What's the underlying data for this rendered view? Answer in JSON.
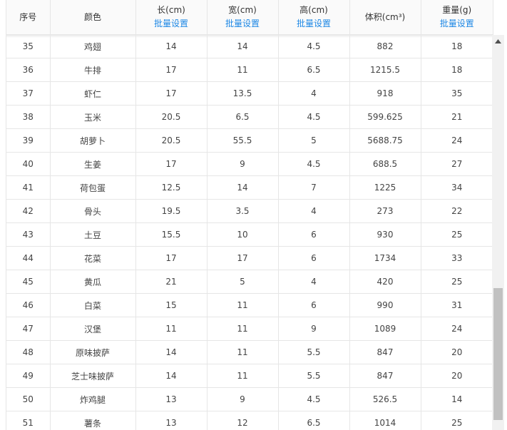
{
  "header": {
    "columns": [
      {
        "title": "序号",
        "link": ""
      },
      {
        "title": "颜色",
        "link": ""
      },
      {
        "title": "长(cm)",
        "link": "批量设置"
      },
      {
        "title": "宽(cm)",
        "link": "批量设置"
      },
      {
        "title": "高(cm)",
        "link": "批量设置"
      },
      {
        "title": "体积(cm³)",
        "link": ""
      },
      {
        "title": "重量(g)",
        "link": "批量设置"
      }
    ]
  },
  "rows": [
    [
      "35",
      "鸡翅",
      "14",
      "14",
      "4.5",
      "882",
      "18"
    ],
    [
      "36",
      "牛排",
      "17",
      "11",
      "6.5",
      "1215.5",
      "18"
    ],
    [
      "37",
      "虾仁",
      "17",
      "13.5",
      "4",
      "918",
      "35"
    ],
    [
      "38",
      "玉米",
      "20.5",
      "6.5",
      "4.5",
      "599.625",
      "21"
    ],
    [
      "39",
      "胡萝卜",
      "20.5",
      "55.5",
      "5",
      "5688.75",
      "24"
    ],
    [
      "40",
      "生姜",
      "17",
      "9",
      "4.5",
      "688.5",
      "27"
    ],
    [
      "41",
      "荷包蛋",
      "12.5",
      "14",
      "7",
      "1225",
      "34"
    ],
    [
      "42",
      "骨头",
      "19.5",
      "3.5",
      "4",
      "273",
      "22"
    ],
    [
      "43",
      "土豆",
      "15.5",
      "10",
      "6",
      "930",
      "25"
    ],
    [
      "44",
      "花菜",
      "17",
      "17",
      "6",
      "1734",
      "33"
    ],
    [
      "45",
      "黄瓜",
      "21",
      "5",
      "4",
      "420",
      "25"
    ],
    [
      "46",
      "白菜",
      "15",
      "11",
      "6",
      "990",
      "31"
    ],
    [
      "47",
      "汉堡",
      "11",
      "11",
      "9",
      "1089",
      "24"
    ],
    [
      "48",
      "原味披萨",
      "14",
      "11",
      "5.5",
      "847",
      "20"
    ],
    [
      "49",
      "芝士味披萨",
      "14",
      "11",
      "5.5",
      "847",
      "20"
    ],
    [
      "50",
      "炸鸡腿",
      "13",
      "9",
      "4.5",
      "526.5",
      "14"
    ],
    [
      "51",
      "薯条",
      "13",
      "12",
      "6.5",
      "1014",
      "25"
    ]
  ],
  "scrollbar": {
    "position_fraction": 0.72
  },
  "icons": {
    "scroll_up": "chevron-up-icon"
  }
}
